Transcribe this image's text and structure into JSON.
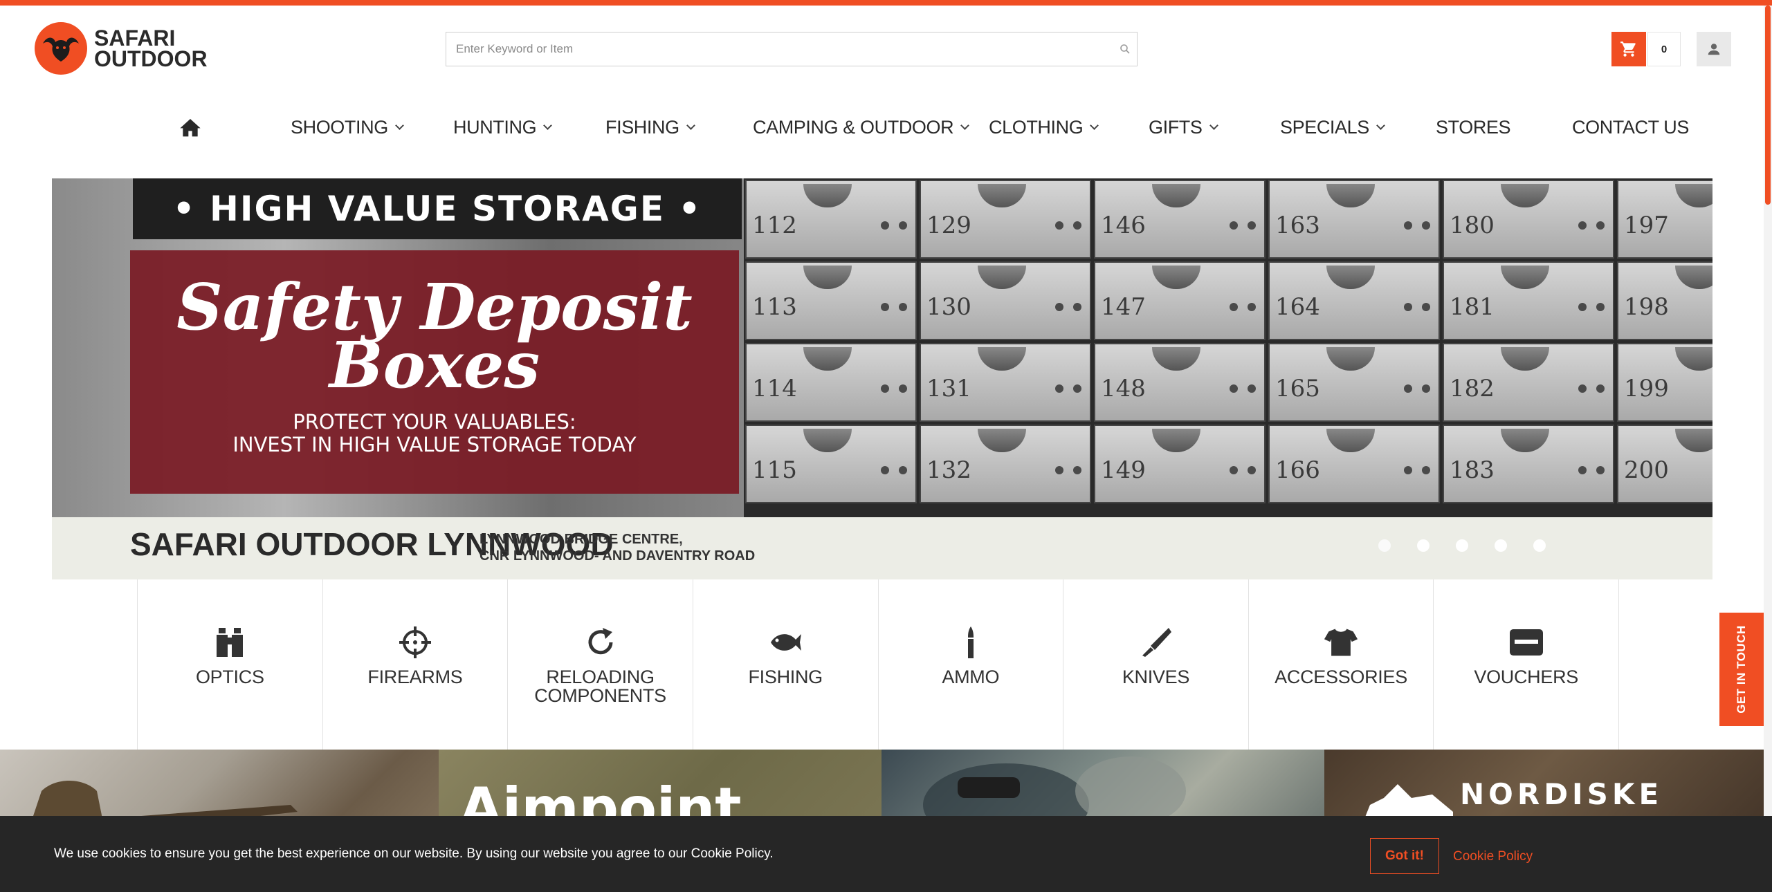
{
  "brand": {
    "name_line1": "SAFARI",
    "name_line2": "OUTDOOR",
    "accent_color": "#f04e23"
  },
  "search": {
    "placeholder": "Enter Keyword or Item",
    "value": ""
  },
  "cart": {
    "count": "0",
    "icon": "cart-icon"
  },
  "user": {
    "icon": "user-icon"
  },
  "nav": {
    "home_icon": "home-icon",
    "items": [
      {
        "label": "SHOOTING",
        "has_dropdown": true
      },
      {
        "label": "HUNTING",
        "has_dropdown": true
      },
      {
        "label": "FISHING",
        "has_dropdown": true
      },
      {
        "label": "CAMPING & OUTDOOR",
        "has_dropdown": true
      },
      {
        "label": "CLOTHING",
        "has_dropdown": true
      },
      {
        "label": "GIFTS",
        "has_dropdown": true
      },
      {
        "label": "SPECIALS",
        "has_dropdown": true
      },
      {
        "label": "STORES",
        "has_dropdown": false
      },
      {
        "label": "CONTACT US",
        "has_dropdown": false
      }
    ]
  },
  "hero": {
    "banner": "• HIGH VALUE STORAGE •",
    "title_line1": "Safety Deposit",
    "title_line2": "Boxes",
    "sub_line1": "PROTECT YOUR VALUABLES:",
    "sub_line2": "INVEST IN HIGH VALUE STORAGE TODAY",
    "store_name": "SAFARI OUTDOOR LYNNWOOD",
    "address_line1": "LYNNWOOD BRIDGE CENTRE,",
    "address_line2": "CNR LYNNWOOD- AND DAVENTRY ROAD",
    "locker_numbers": [
      [
        "112",
        "129",
        "146",
        "163",
        "180",
        "197"
      ],
      [
        "113",
        "130",
        "147",
        "164",
        "181",
        "198"
      ],
      [
        "114",
        "131",
        "148",
        "165",
        "182",
        "199"
      ],
      [
        "115",
        "132",
        "149",
        "166",
        "183",
        "200"
      ]
    ],
    "slide_count": 5,
    "active_slide": 1
  },
  "categories": [
    {
      "label": "OPTICS",
      "icon": "binoculars-icon"
    },
    {
      "label": "FIREARMS",
      "icon": "crosshair-icon"
    },
    {
      "label": "RELOADING\nCOMPONENTS",
      "icon": "reload-icon"
    },
    {
      "label": "FISHING",
      "icon": "fish-icon"
    },
    {
      "label": "AMMO",
      "icon": "bullet-icon"
    },
    {
      "label": "KNIVES",
      "icon": "knife-icon"
    },
    {
      "label": "ACCESSORIES",
      "icon": "tshirt-icon"
    },
    {
      "label": "VOUCHERS",
      "icon": "card-icon"
    }
  ],
  "get_in_touch": "GET IN TOUCH",
  "brands": [
    {
      "name": ""
    },
    {
      "name": "Aimpoint."
    },
    {
      "name": ""
    },
    {
      "name": "NORDISKE"
    }
  ],
  "cookie": {
    "text": "We use cookies to ensure you get the best experience on our website. By using our website you agree to our Cookie Policy.",
    "button": "Got it!",
    "link": "Cookie Policy"
  }
}
